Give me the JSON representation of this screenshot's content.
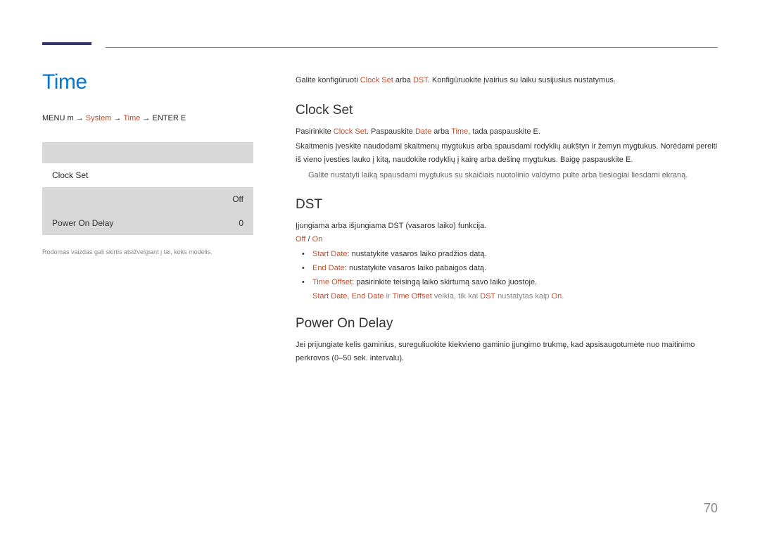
{
  "pageNumber": "70",
  "title": "Time",
  "breadcrumb": {
    "part1": "MENU",
    "icon1": "m",
    "arrow": "→",
    "label1": "System",
    "label2": "Time",
    "part4": "ENTER",
    "icon2": "E"
  },
  "menuPreview": {
    "row1": {
      "label": "Clock Set",
      "value": ""
    },
    "row2": {
      "label": "",
      "value": "Off"
    },
    "row3": {
      "label": "Power On Delay",
      "value": "0"
    }
  },
  "disclaimer": "Rodomas vaizdas gali skirtis atsižvelgiant į tai, koks modelis.",
  "intro": {
    "p1a": "Galite konfigūruoti ",
    "hl1": "Clock Set",
    "p1b": " arba ",
    "hl2": "DST",
    "p1c": ". Konfigūruokite įvairius su laiku susijusius nustatymus."
  },
  "clockSet": {
    "heading": "Clock Set",
    "p1a": "Pasirinkite ",
    "hl1": "Clock Set",
    "p1b": ". Paspauskite ",
    "hl2": "Date",
    "p1c": " arba ",
    "hl3": "Time",
    "p1d": ", tada paspauskite ",
    "hl4": "E",
    "p1e": ".",
    "p2": "Skaitmenis įveskite naudodami skaitmenų mygtukus arba spausdami rodyklių aukštyn ir žemyn mygtukus. Norėdami pereiti iš vieno įvesties lauko į kitą, naudokite rodyklių į kairę arba dešinę mygtukus. Baigę paspauskite",
    "p2end": "E.",
    "note": "Galite nustatyti laiką spausdami mygtukus su skaičiais nuotolinio valdymo pulte arba tiesiogiai liesdami ekraną."
  },
  "dst": {
    "heading": "DST",
    "p1": "Įjungiama arba išjungiama DST (vasaros laiko) funkcija.",
    "off": "Off",
    "sep": " / ",
    "on": "On",
    "b1l": "Start Date",
    "b1t": ": nustatykite vasaros laiko pradžios datą.",
    "b2l": "End Date",
    "b2t": ": nustatykite vasaros laiko pabaigos datą.",
    "b3l": "Time Offset",
    "b3t": ": pasirinkite teisingą laiko skirtumą savo laiko juostoje.",
    "fn1": "Start Date",
    "fn2": ", ",
    "fn3": "End Date",
    "fn4": " ir ",
    "fn5": "Time Offset",
    "fn6": " veikia, tik kai ",
    "fn7": "DST",
    "fn8": " nustatytas kaip ",
    "fn9": "On",
    "fn10": "."
  },
  "powerOnDelay": {
    "heading": "Power On Delay",
    "p1": "Jei prijungiate kelis gaminius, sureguliuokite kiekvieno gaminio įjungimo trukmę, kad apsisaugotumėte nuo maitinimo perkrovos (0–50 sek. intervalu)."
  }
}
